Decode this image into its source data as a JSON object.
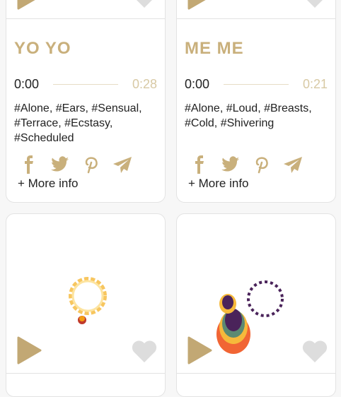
{
  "accent": "#c9b07c",
  "cards": [
    {
      "title": "YO YO",
      "current": "0:00",
      "duration": "0:28",
      "tags": "#Alone, #Ears, #Sensual, #Terrace, #Ecstasy, #Scheduled",
      "more": "+ More info"
    },
    {
      "title": "ME ME",
      "current": "0:00",
      "duration": "0:21",
      "tags": "#Alone, #Loud, #Breasts, #Cold, #Shivering",
      "more": "+ More info"
    }
  ],
  "icons": [
    "play-icon",
    "heart-icon",
    "facebook-icon",
    "twitter-icon",
    "pinterest-icon",
    "send-icon"
  ]
}
